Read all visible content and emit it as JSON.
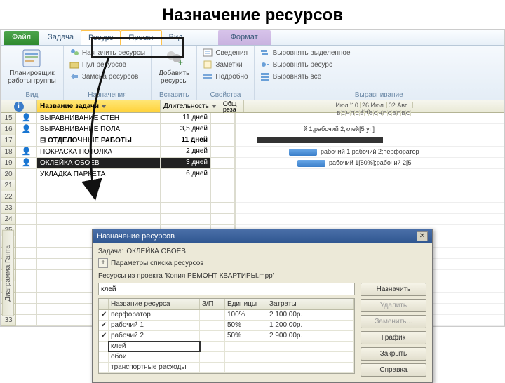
{
  "slide_title": "Назначение ресурсов",
  "tabs": {
    "file": "Файл",
    "task": "Задача",
    "resource": "Ресурс",
    "project": "Проект",
    "view": "Вид",
    "format": "Формат"
  },
  "ribbon": {
    "view": {
      "planner": "Планировщик\nработы группы",
      "group": "Вид"
    },
    "assign": {
      "assign": "Назначить ресурсы",
      "pool": "Пул ресурсов",
      "replace": "Замена ресурсов",
      "group": "Назначения"
    },
    "insert": {
      "add": "Добавить\nресурсы",
      "group": "Вставить"
    },
    "props": {
      "info": "Сведения",
      "notes": "Заметки",
      "details": "Подробно",
      "group": "Свойства"
    },
    "level": {
      "sel": "Выровнять выделенное",
      "res": "Выровнять ресурс",
      "all": "Выровнять все",
      "group": "Выравнивание"
    }
  },
  "grid": {
    "hdr_name": "Название задачи",
    "hdr_dur": "Длительность",
    "hdr_res": "Общ\nреза",
    "months": [
      "Июл '10",
      "26 Июл '10",
      "02 Авг"
    ],
    "days": [
      "В",
      "С",
      "Ч",
      "П",
      "С",
      "В",
      "П",
      "В",
      "С",
      "Ч",
      "П",
      "С",
      "В",
      "П",
      "В",
      "С"
    ]
  },
  "tasks": [
    {
      "n": "15",
      "icon": "person",
      "name": "ВЫРАВНИВАНИЕ СТЕН",
      "dur": "11 дней"
    },
    {
      "n": "16",
      "icon": "person",
      "name": "ВЫРАВНИВАНИЕ ПОЛА",
      "dur": "3,5 дней",
      "gantt_label": "й 1;рабочий 2;клей[5 уп]"
    },
    {
      "n": "17",
      "icon": "",
      "name": "⊟ ОТДЕЛОЧНЫЕ РАБОТЫ",
      "dur": "11 дней",
      "bold": true,
      "summary": true
    },
    {
      "n": "18",
      "icon": "person",
      "name": "ПОКРАСКА ПОТОЛКА",
      "dur": "2 дней",
      "gantt_label": "рабочий 1;рабочий 2;перфоратор",
      "bar": true
    },
    {
      "n": "19",
      "icon": "person",
      "name": "ОКЛЕЙКА ОБОЕВ",
      "dur": "3 дней",
      "sel": true,
      "gantt_label": "рабочий 1[50%];рабочий 2[5",
      "bar": true
    },
    {
      "n": "20",
      "icon": "",
      "name": "УКЛАДКА ПАРКЕТА",
      "dur": "6 дней"
    },
    {
      "n": "21"
    },
    {
      "n": "22"
    },
    {
      "n": "23"
    },
    {
      "n": "24"
    },
    {
      "n": "25"
    },
    {
      "n": "26"
    },
    {
      "n": "27"
    },
    {
      "n": "28"
    },
    {
      "n": "29"
    },
    {
      "n": "30"
    },
    {
      "n": "31"
    },
    {
      "n": "32"
    },
    {
      "n": "33"
    }
  ],
  "side_label": "Диаграмма Ганта",
  "dialog": {
    "title": "Назначение ресурсов",
    "task_line_label": "Задача:",
    "task_line_value": "ОКЛЕЙКА ОБОЕВ",
    "params": "Параметры списка ресурсов",
    "project_line": "Ресурсы из проекта 'Копия РЕМОНТ КВАРТИРЫ.mpp'",
    "search_value": "клей",
    "hdr": {
      "name": "Название ресурса",
      "rd": "З/П",
      "units": "Единицы",
      "cost": "Затраты"
    },
    "rows": [
      {
        "chk": true,
        "name": "перфоратор",
        "units": "100%",
        "cost": "2 100,00р."
      },
      {
        "chk": true,
        "name": "рабочий 1",
        "units": "50%",
        "cost": "1 200,00р."
      },
      {
        "chk": true,
        "name": "рабочий 2",
        "units": "50%",
        "cost": "2 900,00р."
      },
      {
        "chk": false,
        "name": "клей",
        "edit": true
      },
      {
        "chk": false,
        "name": "обои"
      },
      {
        "chk": false,
        "name": "транспортные расходы"
      }
    ],
    "btns": {
      "assign": "Назначить",
      "remove": "Удалить",
      "replace": "Заменить...",
      "graph": "График",
      "close": "Закрыть",
      "help": "Справка"
    }
  }
}
